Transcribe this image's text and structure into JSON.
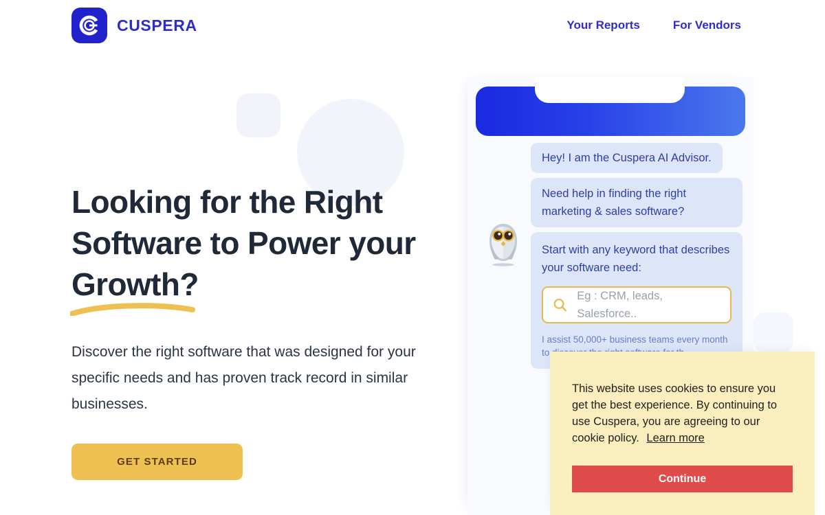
{
  "brand": {
    "name": "CUSPERA",
    "logo_icon": "cuspera-c-logo-icon",
    "logo_color": "#2222cc"
  },
  "nav": {
    "links": [
      {
        "label": "Your Reports"
      },
      {
        "label": "For Vendors"
      }
    ]
  },
  "hero": {
    "title_line1": "Looking for the Right",
    "title_line2": "Software to Power your",
    "title_line3": "Growth?",
    "underline_color": "#eec052",
    "subtitle": "Discover the right software that was designed for your specific needs and has proven track record in similar businesses.",
    "cta_label": "GET STARTED",
    "cta_color": "#eec052",
    "cta_text_color": "#5a3c12"
  },
  "chat": {
    "avatar_icon": "owl-mascot-avatar",
    "header_gradient_from": "#1a2ae0",
    "header_gradient_to": "#4a78ec",
    "bubble_color": "#dde5f8",
    "bubble_text_color": "#2f3fa8",
    "messages": [
      {
        "text": "Hey! I am the Cuspera AI Advisor."
      },
      {
        "text": "Need help in finding the right marketing & sales software?"
      },
      {
        "text": "Start with any keyword that describes your software need:"
      }
    ],
    "search": {
      "icon": "search-icon",
      "placeholder": "Eg : CRM, leads, Salesforce..",
      "value": "",
      "border_color": "#e7b84b"
    },
    "assist_note": "I assist 50,000+ business teams every month to discover the right software for th"
  },
  "cookie_banner": {
    "message": "This website uses cookies to ensure you get the best experience. By continuing to use Cuspera, you are agreeing to our cookie policy.",
    "learn_more_label": "Learn more",
    "continue_label": "Continue",
    "background_color": "#faeebe",
    "continue_color": "#e04b4b"
  }
}
